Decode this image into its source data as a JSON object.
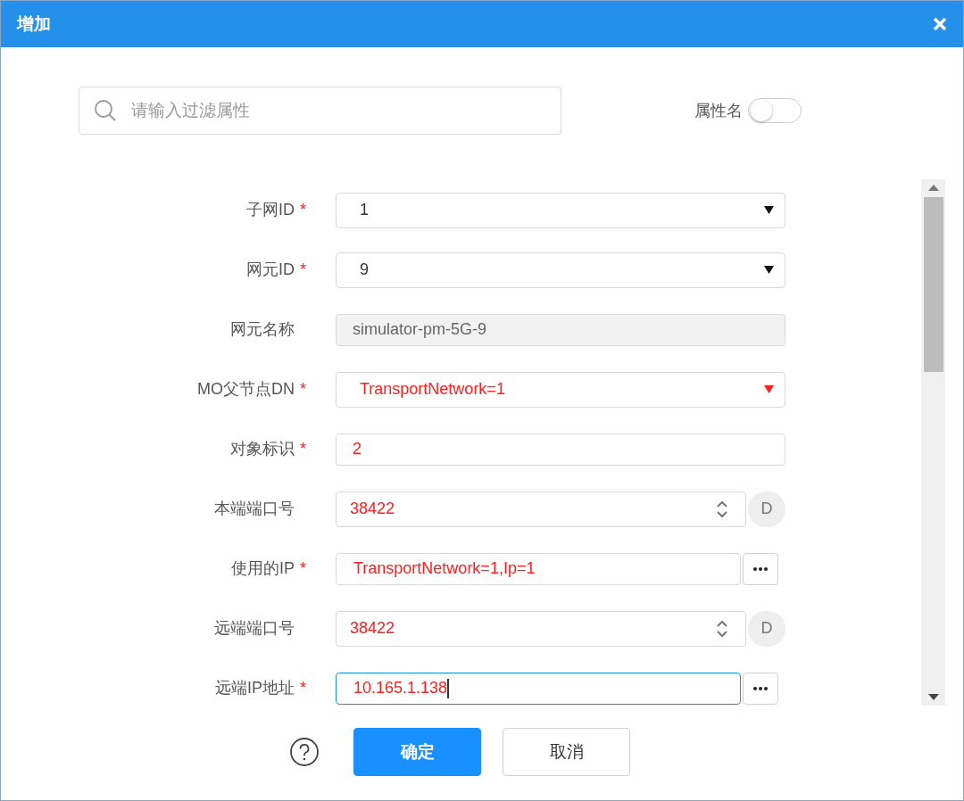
{
  "window": {
    "title": "增加"
  },
  "filter": {
    "placeholder": "请输入过滤属性",
    "toggle_label": "属性名",
    "toggle_on": false
  },
  "fields": [
    {
      "kind": "select",
      "label": "子网ID",
      "mark": "*",
      "value": "1",
      "modified": false,
      "focused": false
    },
    {
      "kind": "select",
      "label": "网元ID",
      "mark": "*",
      "value": "9",
      "modified": false,
      "focused": false
    },
    {
      "kind": "readonly",
      "label": "网元名称",
      "value": "simulator-pm-5G-9",
      "modified": false,
      "focused": false
    },
    {
      "kind": "select",
      "label": "MO父节点DN",
      "mark": "*",
      "value": "TransportNetwork=1",
      "modified": true,
      "focused": false
    },
    {
      "kind": "text",
      "label": "对象标识",
      "mark": "*",
      "value": "2",
      "modified": true,
      "focused": false
    },
    {
      "kind": "number",
      "label": "本端端口号",
      "value": "38422",
      "side_button": "D",
      "modified": true,
      "focused": false
    },
    {
      "kind": "picker",
      "label": "使用的IP",
      "mark": "*",
      "value": "TransportNetwork=1,Ip=1",
      "modified": true,
      "focused": false
    },
    {
      "kind": "number",
      "label": "远端端口号",
      "value": "38422",
      "side_button": "D",
      "modified": true,
      "focused": false
    },
    {
      "kind": "picker",
      "label": "远端IP地址",
      "mark": "*",
      "value": "10.165.1.138",
      "modified": true,
      "focused": true
    }
  ],
  "buttons": [
    {
      "label": "确定",
      "kind": "primary"
    },
    {
      "label": "取消",
      "kind": "secondary"
    }
  ]
}
